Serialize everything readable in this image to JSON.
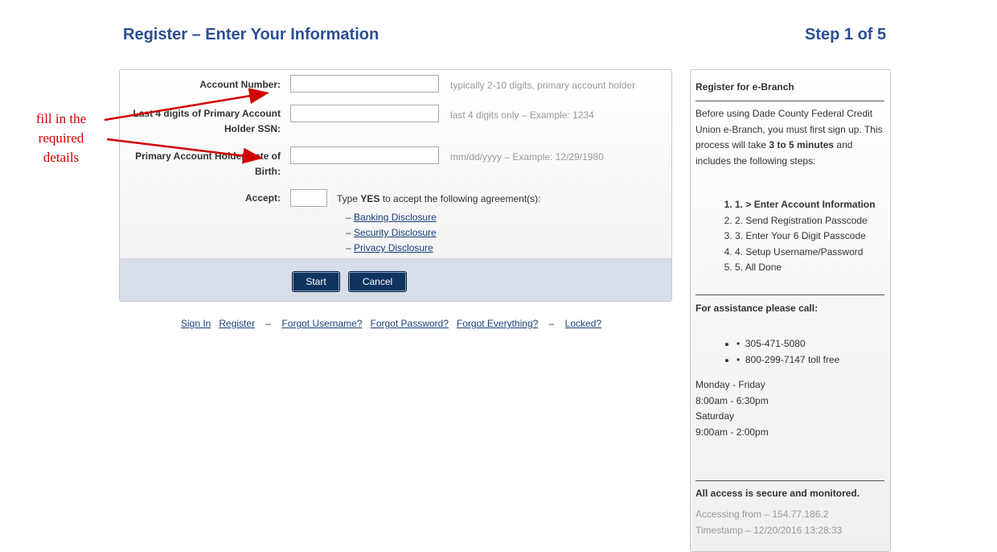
{
  "header": {
    "title": "Register – Enter Your Information",
    "step": "Step 1 of 5"
  },
  "form": {
    "fields": [
      {
        "label": "Account Number:",
        "value": "",
        "hint": "typically 2-10 digits, primary account holder"
      },
      {
        "label_line1": "Last 4 digits of Primary Account",
        "label_line2": "Holder SSN:",
        "value": "",
        "hint": "last 4 digits only – Example: 1234"
      },
      {
        "label_line1": "Primary Account Holder Date of",
        "label_line2": "Birth:",
        "value": "",
        "hint": "mm/dd/yyyy – Example: 12/29/1980"
      }
    ],
    "accept": {
      "label": "Accept:",
      "value": "",
      "text_prefix": "Type ",
      "text_bold": "YES",
      "text_suffix": " to accept the following agreement(s):",
      "dash": "–",
      "disclosures": [
        "Banking Disclosure",
        "Security Disclosure",
        "Privacy Disclosure"
      ]
    },
    "buttons": {
      "start": "Start",
      "cancel": "Cancel"
    }
  },
  "links": {
    "sign_in": "Sign In",
    "register": "Register",
    "sep": "–",
    "forgot_username": "Forgot Username?",
    "forgot_password": "Forgot Password?",
    "forgot_everything": "Forgot Everything?",
    "locked": "Locked?"
  },
  "sidebar": {
    "title": "Register for e-Branch",
    "intro_prefix": "Before using Dade County Federal Credit Union e-Branch, you must first sign up. This process will take ",
    "intro_bold": "3 to 5 minutes",
    "intro_suffix": " and includes the following steps:",
    "steps": [
      {
        "num": "1.",
        "label": "> Enter Account Information"
      },
      {
        "num": "2.",
        "label": "Send Registration Passcode"
      },
      {
        "num": "3.",
        "label": "Enter Your 6 Digit Passcode"
      },
      {
        "num": "4.",
        "label": "Setup Username/Password"
      },
      {
        "num": "5.",
        "label": "All Done"
      }
    ],
    "assist_title": "For assistance please call:",
    "bullet": "•",
    "phones": [
      "305-471-5080",
      "800-299-7147 toll free"
    ],
    "hours": [
      "Monday - Friday",
      "8:00am - 6:30pm",
      "Saturday",
      "9:00am - 2:00pm"
    ],
    "secure_title": "All access is secure and monitored.",
    "accessing": "Accessing from – 154.77.186.2",
    "timestamp": "Timestamp – 12/20/2016 13:28:33"
  },
  "annotation": {
    "line1": "fill in the",
    "line2": "required",
    "line3": "details",
    "color": "#d10000"
  }
}
